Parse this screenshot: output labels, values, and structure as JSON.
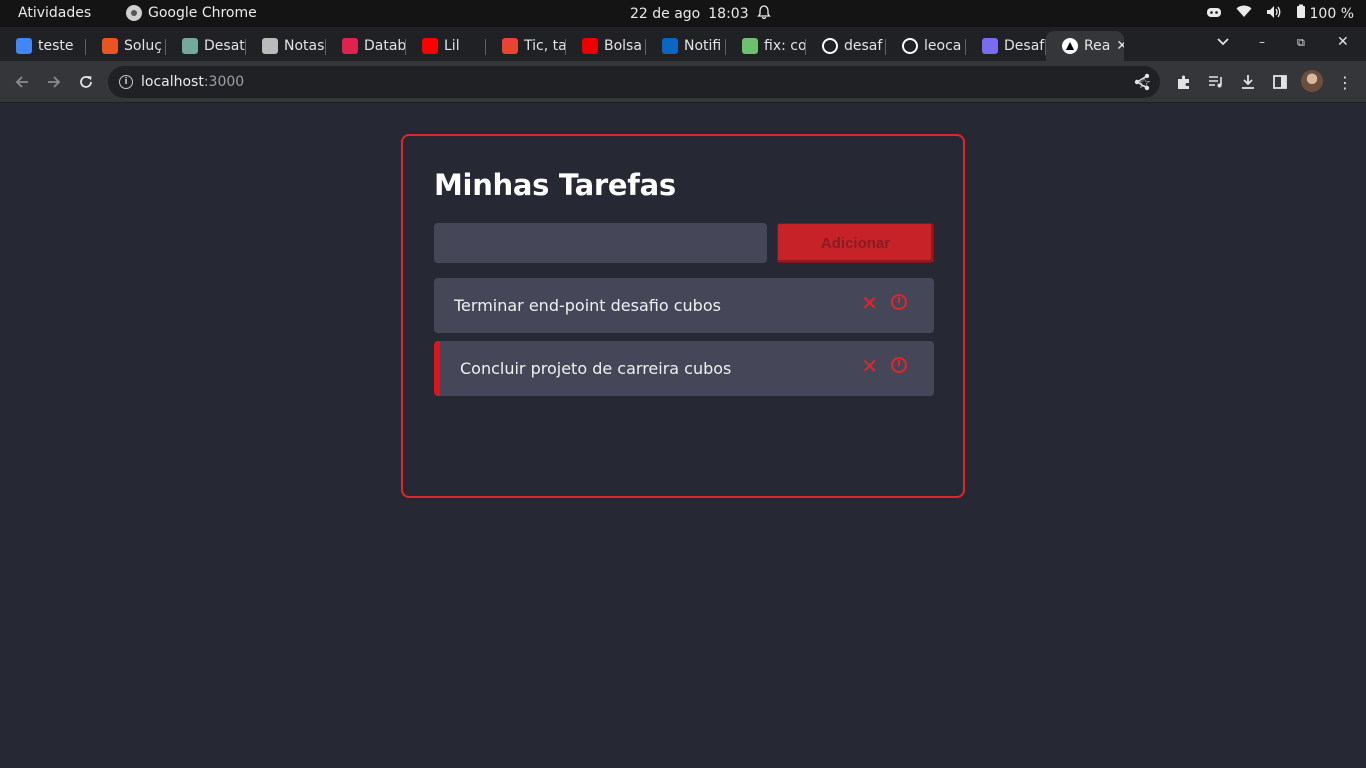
{
  "system_bar": {
    "activities": "Atividades",
    "app_name": "Google Chrome",
    "date": "22 de ago",
    "time": "18:03",
    "battery": "100 %"
  },
  "browser": {
    "tabs": [
      {
        "label": "teste",
        "icon": "google-icon",
        "color": "#4285f4"
      },
      {
        "label": "Soluç",
        "icon": "ubuntu-icon",
        "color": "#e95420"
      },
      {
        "label": "Desat",
        "icon": "chatgpt-icon",
        "color": "#74aa9c"
      },
      {
        "label": "Notas",
        "icon": "apple-icon",
        "color": "#bbbbbb"
      },
      {
        "label": "Datab",
        "icon": "nest-icon",
        "color": "#e0234e"
      },
      {
        "label": "Lil",
        "icon": "youtube-icon",
        "color": "#ff0000"
      },
      {
        "label": "Tic, ta",
        "icon": "gmail-icon",
        "color": "#ea4335"
      },
      {
        "label": "Bolsa",
        "icon": "santander-icon",
        "color": "#ec0000"
      },
      {
        "label": "Notifi",
        "icon": "linkedin-icon",
        "color": "#0a66c2"
      },
      {
        "label": "fix: co",
        "icon": "git-icon",
        "color": "#6fbf73"
      },
      {
        "label": "desaf",
        "icon": "github-icon",
        "color": "#ffffff"
      },
      {
        "label": "leoca",
        "icon": "github-icon",
        "color": "#ffffff"
      },
      {
        "label": "Desaf",
        "icon": "list-icon",
        "color": "#7a6cf0"
      },
      {
        "label": "Rea",
        "icon": "next-icon",
        "color": "#000000"
      }
    ],
    "url_host": "localhost",
    "url_port": ":3000"
  },
  "app": {
    "title": "Minhas Tarefas",
    "input_value": "",
    "input_placeholder": "",
    "add_label": "Adicionar",
    "tasks": [
      {
        "text": "Terminar end-point desafio cubos",
        "flagged": false
      },
      {
        "text": "Concluir projeto de carreira cubos",
        "flagged": true
      }
    ],
    "accent": "#e0262d"
  }
}
